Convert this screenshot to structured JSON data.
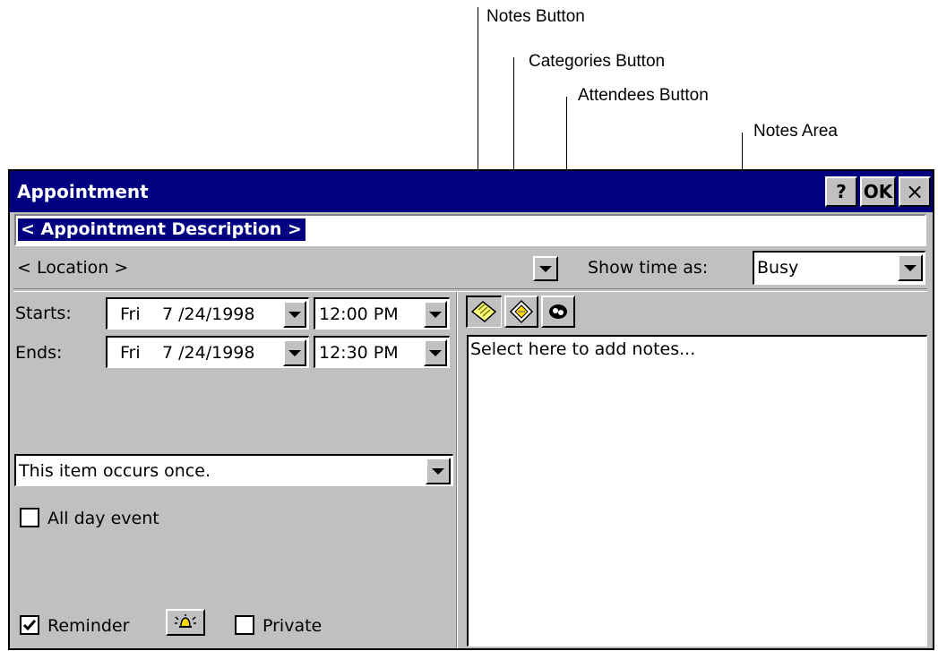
{
  "callouts": {
    "notes_button": "Notes Button",
    "categories_button": "Categories Button",
    "attendees_button": "Attendees Button",
    "notes_area": "Notes Area"
  },
  "window": {
    "title": "Appointment",
    "help_label": "?",
    "ok_label": "OK",
    "close_label": "×"
  },
  "form": {
    "description": "< Appointment Description >",
    "location": "< Location >",
    "show_time_as_label": "Show time as:",
    "show_time_as_value": "Busy",
    "starts_label": "Starts:",
    "start_day": "Fri",
    "start_date": "7 /24/1998",
    "start_time": "12:00 PM",
    "ends_label": "Ends:",
    "end_day": "Fri",
    "end_date": "7 /24/1998",
    "end_time": "12:30 PM",
    "recurrence": "This item occurs once.",
    "all_day_label": "All day event",
    "all_day_checked": false,
    "reminder_label": "Reminder",
    "reminder_checked": true,
    "private_label": "Private",
    "private_checked": false
  },
  "notes": {
    "placeholder": "Select here to add notes..."
  },
  "icons": {
    "notes": "notes-icon",
    "categories": "categories-icon",
    "attendees": "attendees-icon",
    "reminder_sound": "bell-icon"
  },
  "colors": {
    "title_bar": "#000080",
    "face": "#c0c0c0",
    "selection": "#000080"
  }
}
